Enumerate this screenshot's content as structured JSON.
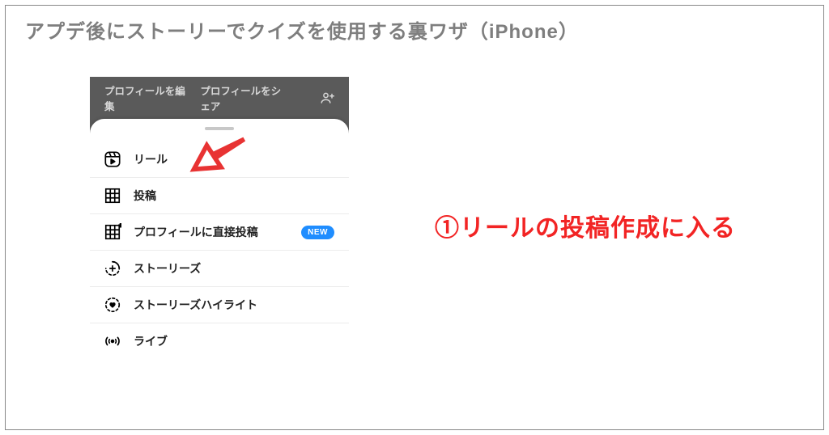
{
  "title": "アプデ後にストーリーでクイズを使用する裏ワザ（iPhone）",
  "profile_bar": {
    "edit": "プロフィールを編集",
    "share": "プロフィールをシェア"
  },
  "menu": {
    "reel": "リール",
    "post": "投稿",
    "direct_post": "プロフィールに直接投稿",
    "direct_post_badge": "NEW",
    "stories": "ストーリーズ",
    "highlights": "ストーリーズハイライト",
    "live": "ライブ"
  },
  "annotation": "①リールの投稿作成に入る"
}
